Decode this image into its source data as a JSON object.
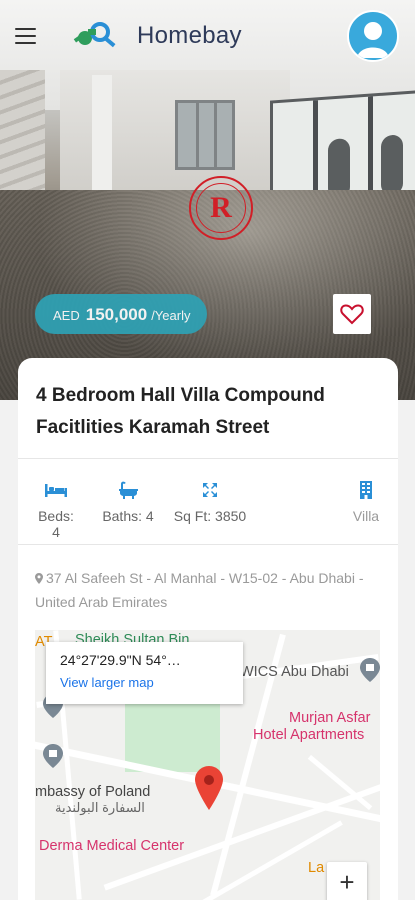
{
  "app": {
    "brand_name": "Homebay",
    "accent_color": "#2ea2b5",
    "icon_color": "#2a8fd6"
  },
  "header": {
    "menu_icon": "hamburger-icon",
    "logo_icon": "keys-logo-icon",
    "avatar_icon": "user-avatar-icon"
  },
  "hero": {
    "watermark_letter": "R",
    "price": {
      "currency": "AED",
      "amount": "150,000",
      "period": "/Yearly"
    },
    "favorite_icon": "heart-icon"
  },
  "listing": {
    "title": "4 Bedroom Hall Villa Compound Facitlities Karamah Street",
    "features": [
      {
        "icon": "bed-icon",
        "label": "Beds: 4"
      },
      {
        "icon": "bath-icon",
        "label": "Baths: 4"
      },
      {
        "icon": "area-icon",
        "label": "Sq Ft: 3850"
      }
    ],
    "type": {
      "icon": "building-icon",
      "label": "Villa"
    },
    "address": "37 Al Safeeh St - Al Manhal - W15-02 - Abu Dhabi - United Arab Emirates"
  },
  "map": {
    "popup_coords": "24°27'29.9\"N 54°…",
    "popup_link": "View larger map",
    "labels": {
      "top_left": "AT",
      "sheikh": "Sheikh Sultan Bin",
      "wics": "WICS Abu Dhabi",
      "murjan_1": "Murjan Asfar",
      "murjan_2": "Hotel Apartments",
      "embassy": "mbassy of Poland",
      "embassy_ar": "السفارة البولندية",
      "derma": "Derma Medical Center",
      "lama": "La Ma"
    },
    "zoom_in": "+"
  }
}
